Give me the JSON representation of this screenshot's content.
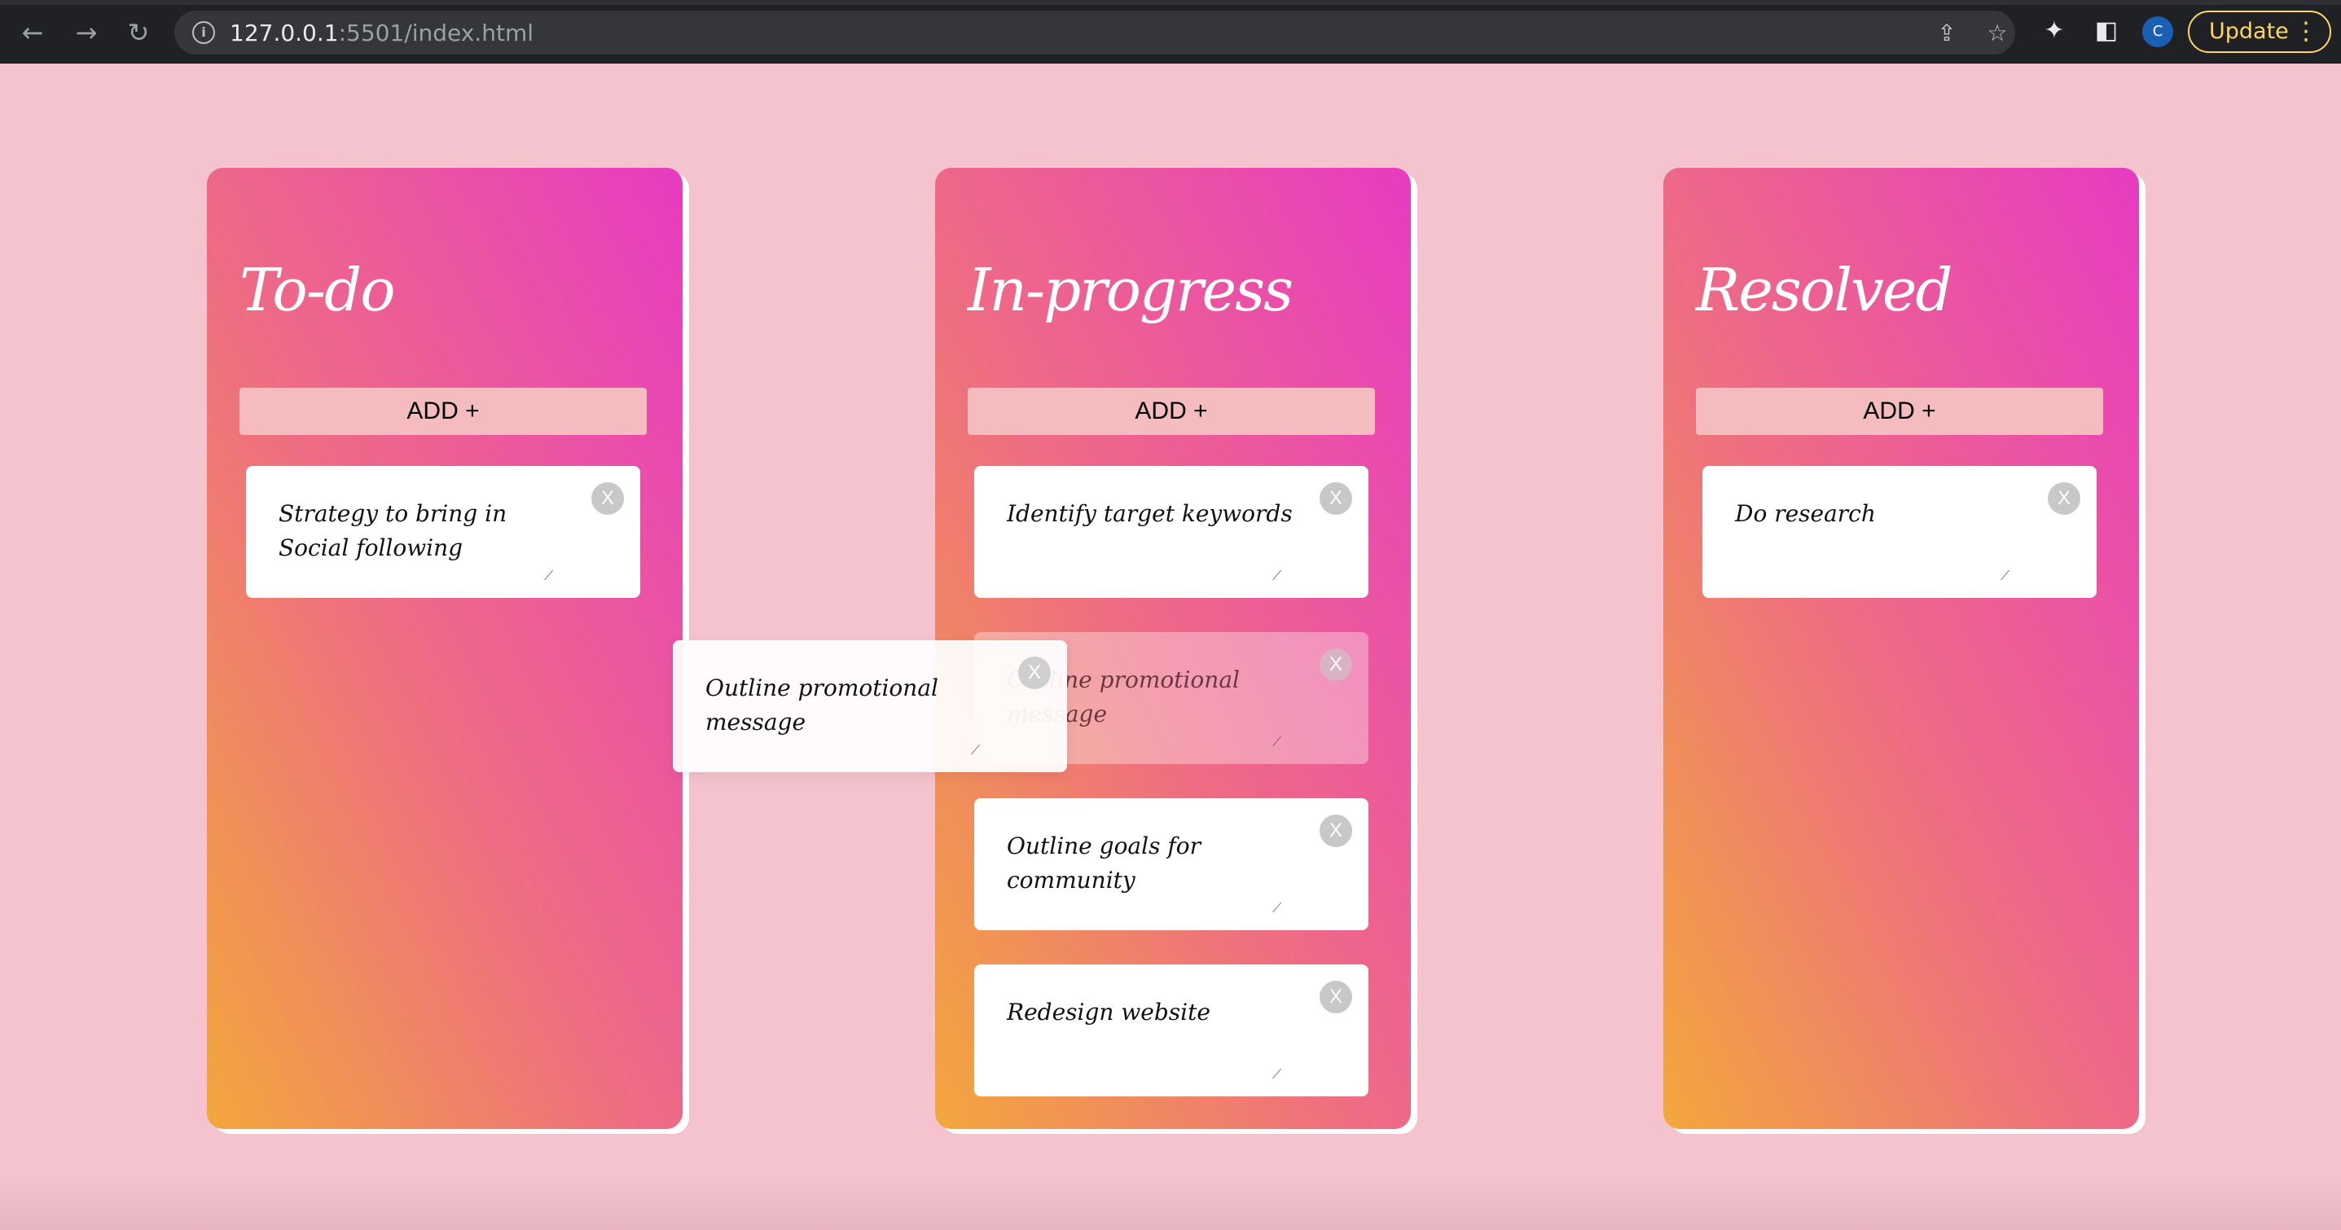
{
  "browser": {
    "url_host": "127.0.0.1",
    "url_rest": ":5501/index.html",
    "update_label": "Update",
    "avatar_initial": "C",
    "icons": {
      "back": "arrow-left-icon",
      "forward": "arrow-right-icon",
      "reload": "reload-icon",
      "info": "info-icon",
      "share": "share-icon",
      "bookmark": "star-icon",
      "extensions": "puzzle-icon",
      "sidepanel": "side-panel-icon",
      "menu": "three-dots-icon"
    }
  },
  "columns": [
    {
      "title": "To-do",
      "add_label": "ADD +",
      "cards": [
        {
          "text": "Strategy to bring in Social following",
          "close": "X"
        }
      ]
    },
    {
      "title": "In-progress",
      "add_label": "ADD +",
      "cards": [
        {
          "text": "Identify target keywords",
          "close": "X"
        },
        {
          "text": "Outline promotional message",
          "close": "X"
        },
        {
          "text": "Outline goals for community",
          "close": "X"
        },
        {
          "text": "Redesign website",
          "close": "X"
        }
      ]
    },
    {
      "title": "Resolved",
      "add_label": "ADD +",
      "cards": [
        {
          "text": "Do research",
          "close": "X"
        }
      ]
    }
  ],
  "dragging_card": {
    "text": "Outline promotional message",
    "close": "X"
  },
  "colors": {
    "background": "#f4c3cd",
    "gradient_start": "#f3a73c",
    "gradient_mid": "#ee6d82",
    "gradient_end": "#e83bc2",
    "add_button": "#f4bcbf",
    "update_accent": "#fdd663"
  }
}
